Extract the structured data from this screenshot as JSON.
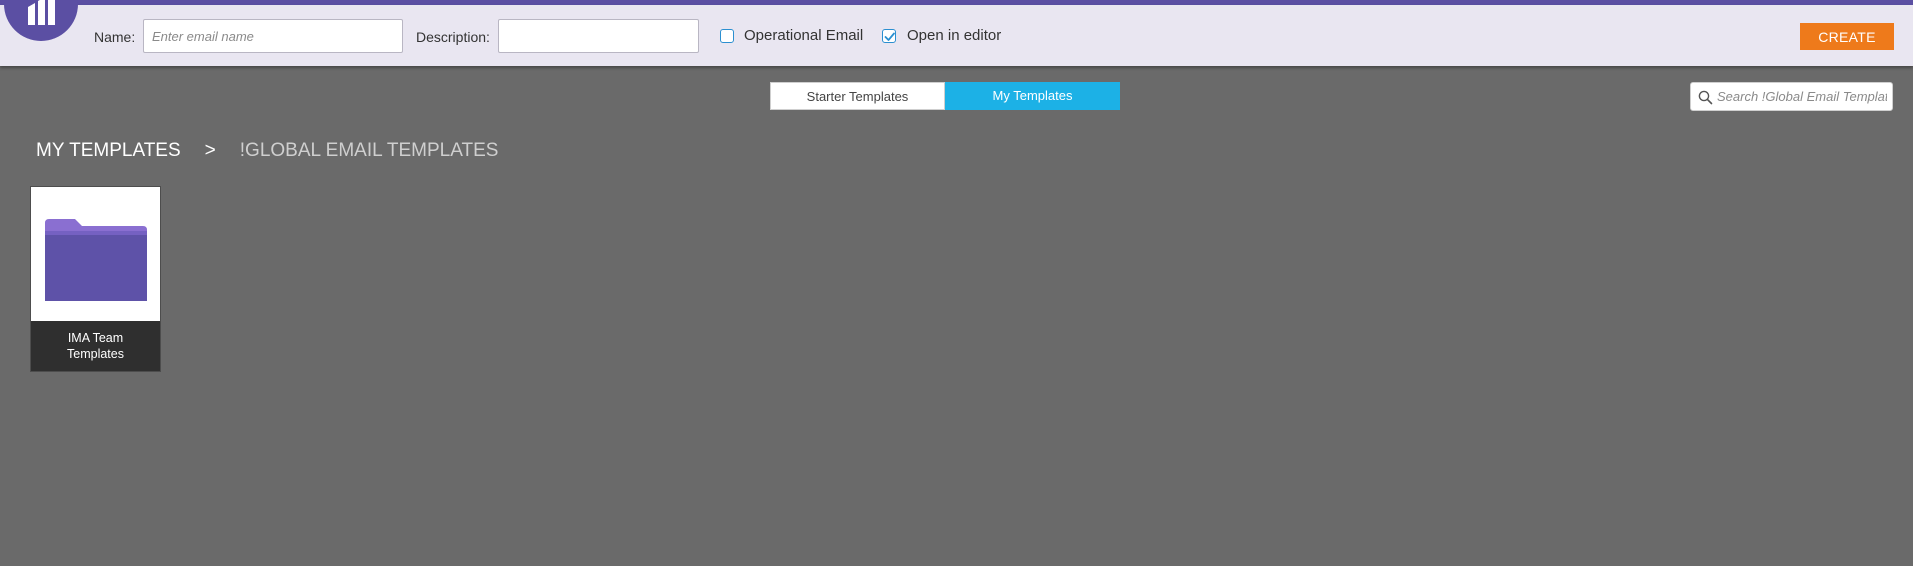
{
  "colors": {
    "brand": "#5b4fa3",
    "header_bg": "#e9e6f1",
    "page_bg": "#6a6a6a",
    "create_button": "#ee7a1b",
    "active_tab": "#1cb1e6",
    "checkbox_accent": "#2b8fd0"
  },
  "header": {
    "logo_icon": "marketo-logo-icon",
    "name_label": "Name:",
    "name_placeholder": "Enter email name",
    "name_value": "",
    "description_label": "Description:",
    "description_value": "",
    "operational_email": {
      "label": "Operational Email",
      "checked": false
    },
    "open_in_editor": {
      "label": "Open in editor",
      "checked": true
    },
    "create_label": "CREATE"
  },
  "tabs": [
    {
      "label": "Starter Templates",
      "active": false
    },
    {
      "label": "My Templates",
      "active": true
    }
  ],
  "search": {
    "icon": "search-icon",
    "placeholder": "Search !Global Email Templates",
    "value": ""
  },
  "breadcrumb": {
    "root": "MY TEMPLATES",
    "separator": ">",
    "current": "!GLOBAL EMAIL TEMPLATES"
  },
  "folders": [
    {
      "name": "IMA Team Templates",
      "icon": "folder-icon"
    }
  ]
}
